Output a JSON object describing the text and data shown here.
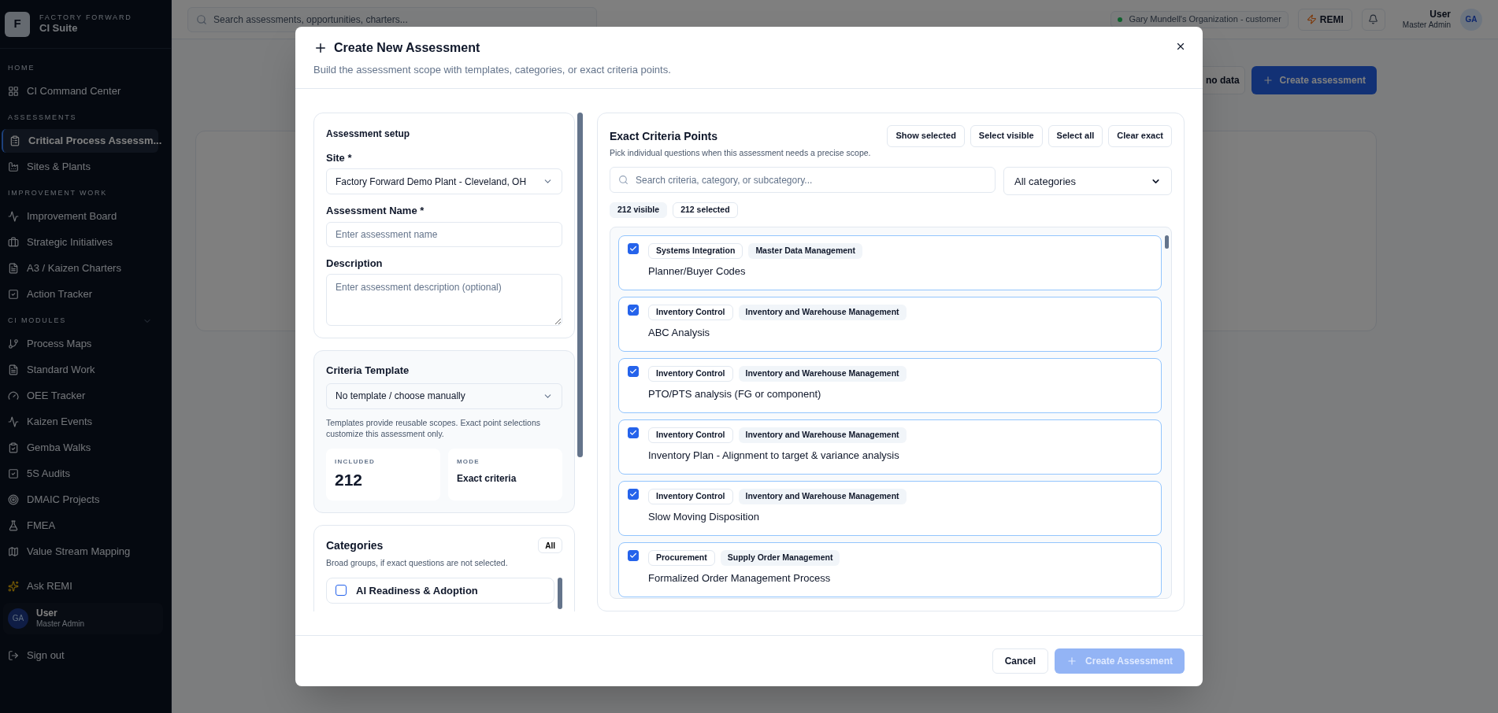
{
  "sidebar": {
    "brand": {
      "logo_letter": "F",
      "company": "FACTORY FORWARD",
      "product": "CI Suite"
    },
    "sections": [
      {
        "label": "HOME",
        "items": [
          {
            "label": "CI Command Center",
            "selected": false
          }
        ]
      },
      {
        "label": "ASSESSMENTS",
        "items": [
          {
            "label": "Critical Process Assessm...",
            "selected": true
          },
          {
            "label": "Sites & Plants",
            "selected": false
          }
        ]
      },
      {
        "label": "IMPROVEMENT WORK",
        "items": [
          {
            "label": "Improvement Board",
            "selected": false
          },
          {
            "label": "Strategic Initiatives",
            "selected": false
          },
          {
            "label": "A3 / Kaizen Charters",
            "selected": false
          },
          {
            "label": "Action Tracker",
            "selected": false
          }
        ]
      },
      {
        "label": "CI MODULES",
        "expanded": true,
        "items": [
          {
            "label": "Process Maps",
            "selected": false
          },
          {
            "label": "Standard Work",
            "selected": false
          },
          {
            "label": "OEE Tracker",
            "selected": false
          },
          {
            "label": "Kaizen Events",
            "selected": false
          },
          {
            "label": "Gemba Walks",
            "selected": false
          },
          {
            "label": "5S Audits",
            "selected": false
          },
          {
            "label": "DMAIC Projects",
            "selected": false
          },
          {
            "label": "FMEA",
            "selected": false
          },
          {
            "label": "Value Stream Mapping",
            "selected": false
          }
        ]
      }
    ],
    "ask_remi": "Ask REMI",
    "user": {
      "initials": "GA",
      "name": "User",
      "role": "Master Admin"
    },
    "sign_out": "Sign out"
  },
  "top_bar": {
    "search_placeholder": "Search assessments, opportunities, charters...",
    "organization": "Gary Mundell's Organization - customer",
    "remi_button": "REMI",
    "user": {
      "name": "User",
      "role": "Master Admin",
      "initials": "GA"
    }
  },
  "page": {
    "buttons": [
      {
        "label": "no data",
        "kind": "outline"
      },
      {
        "label": "Create assessment",
        "kind": "primary"
      }
    ]
  },
  "modal": {
    "title": "Create New Assessment",
    "subtitle": "Build the assessment scope with templates, categories, or exact criteria points.",
    "setup": {
      "heading": "Assessment setup",
      "fields": [
        {
          "kind": "select",
          "label": "Site *",
          "value": "Factory Forward Demo Plant - Cleveland, OH"
        },
        {
          "kind": "input",
          "label": "Assessment Name *",
          "placeholder": "Enter assessment name"
        },
        {
          "kind": "textarea",
          "label": "Description",
          "placeholder": "Enter assessment description (optional)"
        }
      ]
    },
    "template": {
      "label": "Criteria Template",
      "value": "No template / choose manually",
      "hint": "Templates provide reusable scopes. Exact point selections customize this assessment only.",
      "stats": [
        {
          "kind": "big",
          "label": "INCLUDED",
          "value": "212"
        },
        {
          "kind": "small",
          "label": "MODE",
          "value": "Exact criteria"
        }
      ]
    },
    "categories": {
      "title": "Categories",
      "all_button": "All",
      "hint": "Broad groups, if exact questions are not selected.",
      "items": [
        {
          "label": "AI Readiness & Adoption",
          "checked": false
        }
      ]
    },
    "criteria": {
      "title": "Exact Criteria Points",
      "subtitle": "Pick individual questions when this assessment needs a precise scope.",
      "buttons": [
        "Show selected",
        "Select visible",
        "Select all",
        "Clear exact"
      ],
      "search_placeholder": "Search criteria, category, or subcategory...",
      "category_filter": "All categories",
      "counts": [
        {
          "kind": "filled",
          "label": "212 visible"
        },
        {
          "kind": "outline",
          "label": "212 selected"
        }
      ],
      "items": [
        {
          "checked": true,
          "category": "Systems Integration",
          "subcategory": "Master Data Management",
          "title": "Planner/Buyer Codes"
        },
        {
          "checked": true,
          "category": "Inventory Control",
          "subcategory": "Inventory and Warehouse Management",
          "title": "ABC Analysis"
        },
        {
          "checked": true,
          "category": "Inventory Control",
          "subcategory": "Inventory and Warehouse Management",
          "title": "PTO/PTS analysis (FG or component)"
        },
        {
          "checked": true,
          "category": "Inventory Control",
          "subcategory": "Inventory and Warehouse Management",
          "title": "Inventory Plan - Alignment to target & variance analysis"
        },
        {
          "checked": true,
          "category": "Inventory Control",
          "subcategory": "Inventory and Warehouse Management",
          "title": "Slow Moving Disposition"
        },
        {
          "checked": true,
          "category": "Procurement",
          "subcategory": "Supply Order Management",
          "title": "Formalized Order Management Process"
        }
      ]
    },
    "footer": {
      "cancel": "Cancel",
      "create": {
        "label": "Create Assessment",
        "disabled": true
      }
    }
  }
}
